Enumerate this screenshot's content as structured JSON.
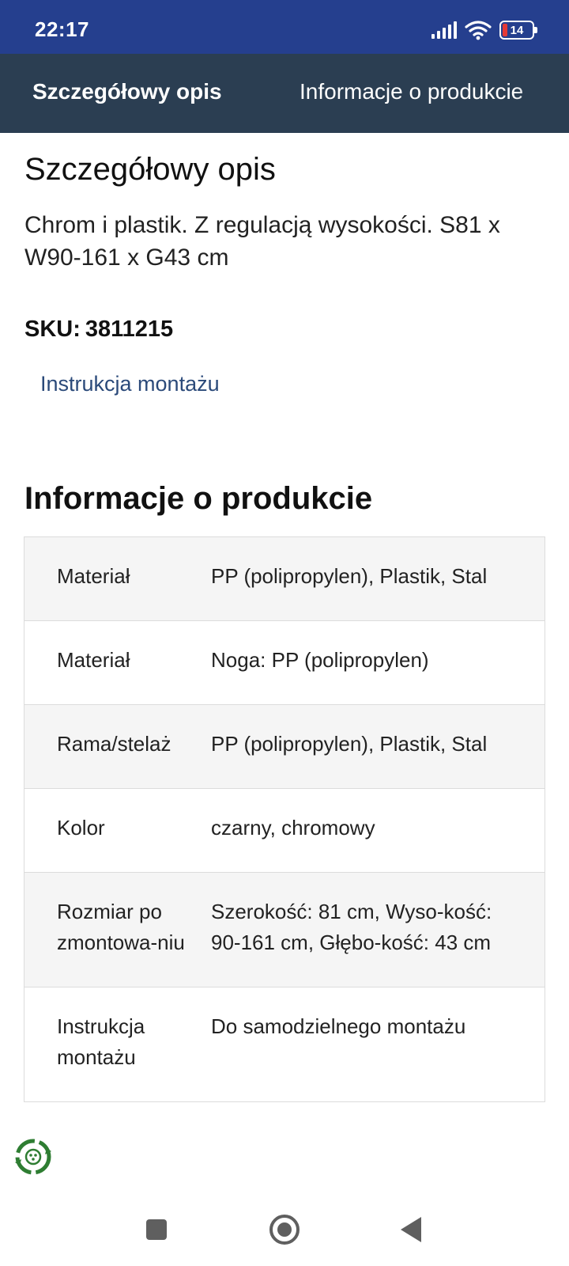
{
  "status_bar": {
    "time": "22:17",
    "battery": "14",
    "icons": [
      "signal-icon",
      "wifi-icon",
      "battery-icon"
    ]
  },
  "tabs": [
    {
      "label": "Szczegółowy opis",
      "active": true
    },
    {
      "label": "Informacje o produkcie",
      "active": false
    }
  ],
  "details": {
    "title": "Szczegółowy opis",
    "description": "Chrom i plastik. Z regulacją wysokości. S81 x W90-161 x G43 cm",
    "sku_label": "SKU:",
    "sku_value": "3811215",
    "manual_link": "Instrukcja montażu"
  },
  "product_info": {
    "title": "Informacje o produkcie",
    "rows": [
      {
        "label": "Materiał",
        "value": "PP (polipropylen), Plastik, Stal"
      },
      {
        "label": "Materiał",
        "value": "Noga: PP (polipropylen)"
      },
      {
        "label": "Rama/stelaż",
        "value": "PP (polipropylen), Plastik, Stal"
      },
      {
        "label": "Kolor",
        "value": "czarny, chromowy"
      },
      {
        "label": "Rozmiar po zmontowa-niu",
        "value": "Szerokość: 81 cm, Wyso-kość: 90-161 cm, Głębo-kość: 43 cm"
      },
      {
        "label": "Instrukcja montażu",
        "value": "Do samodzielnego montażu"
      }
    ]
  },
  "colors": {
    "status_bar": "#253f8e",
    "tab_bar": "#2b3e52",
    "link": "#2b4a7a",
    "widget_green": "#2e7d32"
  },
  "nav_bar": {
    "icons": [
      "recent-apps-icon",
      "home-icon",
      "back-icon"
    ]
  }
}
